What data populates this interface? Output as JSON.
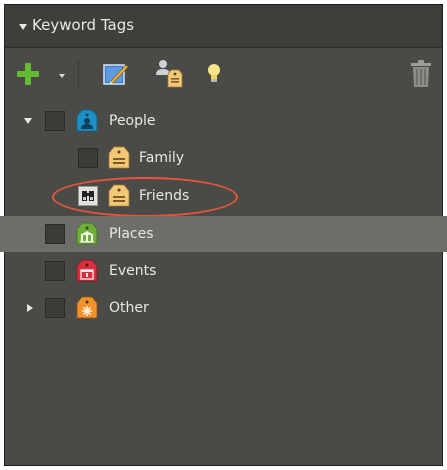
{
  "panel": {
    "title": "Keyword Tags"
  },
  "toolbar": {
    "icons": [
      "plus-icon",
      "dropdown-caret-icon",
      "edit-tag-icon",
      "people-tags-icon",
      "lightbulb-icon",
      "trash-icon"
    ]
  },
  "tags": [
    {
      "label": "People",
      "category": "people",
      "color": "#1e8fc4",
      "expanded": true,
      "checked": false
    },
    {
      "label": "Family",
      "category": "tag",
      "color": "#f2c776",
      "checked": false
    },
    {
      "label": "Friends",
      "category": "tag",
      "color": "#f2c776",
      "checked": true,
      "highlighted": true
    },
    {
      "label": "Places",
      "category": "places",
      "color": "#6fae3b",
      "checked": false,
      "selected": true
    },
    {
      "label": "Events",
      "category": "events",
      "color": "#d62f3f",
      "checked": false
    },
    {
      "label": "Other",
      "category": "other",
      "color": "#f0922e",
      "expanded": false,
      "checked": false
    }
  ],
  "colors": {
    "panel_bg": "#4a4b47",
    "header_bg": "#3e3f3b",
    "selected_row": "#6d6e6a",
    "highlight_ring": "#e8553a",
    "add_green": "#63bb33"
  }
}
